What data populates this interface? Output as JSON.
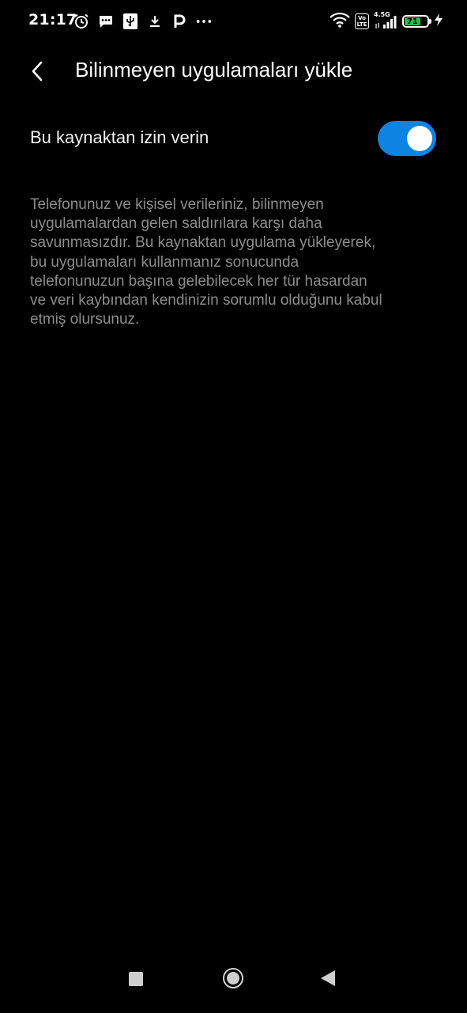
{
  "status_bar": {
    "time": "21:17",
    "left_icons": [
      "alarm-icon",
      "message-icon",
      "usb-icon",
      "download-icon",
      "parking-icon",
      "more-dots-icon"
    ],
    "right_icons": [
      "wifi-icon",
      "volte-icon",
      "signal-icon",
      "battery-icon",
      "charging-icon"
    ],
    "network_type": "4.5G",
    "volte_label": "Vo LTE",
    "battery_level": "71",
    "battery_percent": 71,
    "battery_color": "#2fb84a"
  },
  "header": {
    "back_icon": "chevron-left-icon",
    "title": "Bilinmeyen uygulamaları yükle"
  },
  "setting": {
    "label": "Bu kaynaktan izin verin",
    "toggle_on": true,
    "toggle_color": "#0d84e3"
  },
  "description": "Telefonunuz ve kişisel verileriniz, bilinmeyen\nuygulamalardan gelen saldırılara karşı daha\nsavunmasızdır. Bu kaynaktan uygulama yükleyerek,\nbu uygulamaları kullanmanız sonucunda\ntelefonunuzun başına gelebilecek her tür hasardan\nve veri kaybından kendinizin sorumlu olduğunu kabul\netmiş olursunuz.",
  "nav_bar": {
    "items": [
      "recents-square-icon",
      "home-circle-icon",
      "back-triangle-icon"
    ]
  }
}
